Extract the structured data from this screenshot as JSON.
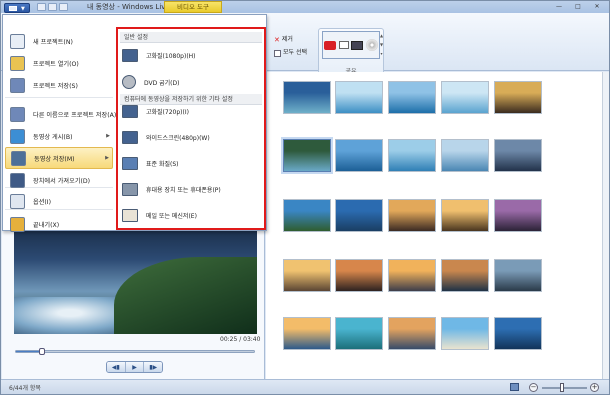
{
  "title_bar": {
    "window_title": "내 동영상 - Windows Live 무비...",
    "context_tab": "비디오 도구",
    "controls": [
      "—",
      "□",
      "✕"
    ]
  },
  "ribbon": {
    "remove_label": "제거",
    "select_all_label": "모두 선택",
    "partial_label": "기",
    "share_group_label": "공유"
  },
  "app_menu": {
    "items": [
      {
        "label": "새 프로젝트(N)",
        "icon": "new-project-icon",
        "color": "#e8eef6"
      },
      {
        "label": "프로젝트 열기(O)",
        "icon": "open-folder-icon",
        "color": "#e9c352"
      },
      {
        "label": "프로젝트 저장(S)",
        "icon": "save-icon",
        "color": "#6f88b8"
      },
      {
        "label": "다른 이름으로 프로젝트 저장(A)",
        "icon": "save-as-icon",
        "color": "#6f88b8"
      },
      {
        "label": "동영상 게시(B)",
        "icon": "globe-icon",
        "color": "#3c8ed4"
      },
      {
        "label": "동영상 저장(M)",
        "icon": "film-save-icon",
        "color": "#4d6f98"
      },
      {
        "label": "장치에서 가져오기(D)",
        "icon": "camera-import-icon",
        "color": "#3f5a86"
      },
      {
        "label": "옵션(I)",
        "icon": "options-icon",
        "color": "#dfe6f0"
      },
      {
        "label": "끝내기(X)",
        "icon": "exit-icon",
        "color": "#e5b03c"
      }
    ],
    "submenu_arrow": "▶",
    "save_movie_submenu": {
      "header_common": "일반 설정",
      "header_computer": "컴퓨터에 동영상을 저장하기 위한 기타 설정",
      "items_common": [
        {
          "label": "고화질(1080p)(H)",
          "icon": "hd-1080-icon",
          "color": "#44628f"
        },
        {
          "label": "DVD 굽기(D)",
          "icon": "dvd-icon",
          "color": "#b7bcc4"
        }
      ],
      "items_computer": [
        {
          "label": "고화질(720p)(I)",
          "icon": "hd-720-icon",
          "color": "#44628f"
        },
        {
          "label": "와이드스크린(480p)(W)",
          "icon": "widescreen-icon",
          "color": "#44628f"
        },
        {
          "label": "표준 화질(S)",
          "icon": "standard-quality-icon",
          "color": "#5a7fb3"
        },
        {
          "label": "휴대용 장치 또는 휴대폰용(P)",
          "icon": "mobile-device-icon",
          "color": "#8796aa"
        },
        {
          "label": "메일 또는 메신저(E)",
          "icon": "email-icon",
          "color": "#e9e3d6"
        }
      ]
    }
  },
  "preview": {
    "time": "00:25 / 03:40",
    "progress": 0.11,
    "transport": [
      "◀▮",
      "▶",
      "▮▶"
    ]
  },
  "storyboard": {
    "thumbnails": [
      {
        "top": "#2a5f9a",
        "bottom": "#6fb0c9",
        "selected": false
      },
      {
        "top": "#bfe0f2",
        "bottom": "#3c8fc4",
        "selected": false
      },
      {
        "top": "#8fc2e6",
        "bottom": "#1d6fa9",
        "selected": false
      },
      {
        "top": "#cde6f4",
        "bottom": "#5aa3cf",
        "selected": false
      },
      {
        "top": "#d8ac57",
        "bottom": "#3a2b1f",
        "selected": false
      },
      {
        "top": "#2e5a3c",
        "bottom": "#6aa9c7",
        "selected": true
      },
      {
        "top": "#5ea2d8",
        "bottom": "#1c5f96",
        "selected": false
      },
      {
        "top": "#9ccde8",
        "bottom": "#2f7fb5",
        "selected": false
      },
      {
        "top": "#b8d5ea",
        "bottom": "#4a86b3",
        "selected": false
      },
      {
        "top": "#6d88a8",
        "bottom": "#22324a",
        "selected": false
      },
      {
        "top": "#3a86c4",
        "bottom": "#2f5d2e",
        "selected": false
      },
      {
        "top": "#2b6bb0",
        "bottom": "#1a3e63",
        "selected": false
      },
      {
        "top": "#e2a85a",
        "bottom": "#3b2a23",
        "selected": false
      },
      {
        "top": "#f0bf6e",
        "bottom": "#49351f",
        "selected": false
      },
      {
        "top": "#9a6aa8",
        "bottom": "#2b2236",
        "selected": false
      },
      {
        "top": "#f0c270",
        "bottom": "#5a4533",
        "selected": false
      },
      {
        "top": "#d7864b",
        "bottom": "#2d2220",
        "selected": false
      },
      {
        "top": "#f1b25b",
        "bottom": "#3d3d4a",
        "selected": false
      },
      {
        "top": "#c9874e",
        "bottom": "#1f3246",
        "selected": false
      },
      {
        "top": "#7a9bb7",
        "bottom": "#2a3a49",
        "selected": false
      },
      {
        "top": "#f3bc69",
        "bottom": "#2d5a8a",
        "selected": false
      },
      {
        "top": "#4ab4cf",
        "bottom": "#1c6f7a",
        "selected": false
      },
      {
        "top": "#e3a35f",
        "bottom": "#374b69",
        "selected": false
      },
      {
        "top": "#6fb8e6",
        "bottom": "#e9e3cf",
        "selected": false
      },
      {
        "top": "#2d6eb2",
        "bottom": "#12345a",
        "selected": false
      }
    ]
  },
  "status": {
    "text": "6/44개 항목",
    "zoom": 0.45
  }
}
